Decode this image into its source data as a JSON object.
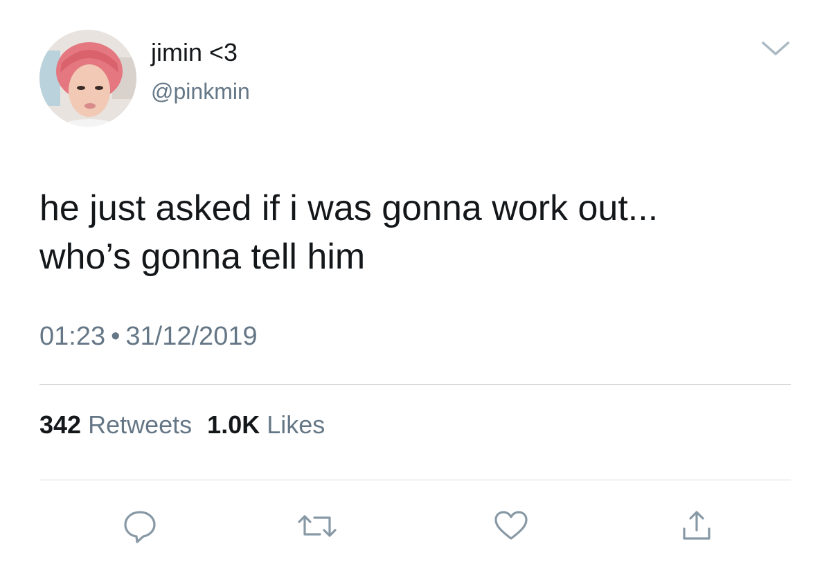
{
  "user": {
    "display_name": "jimin <3",
    "handle": "@pinkmin",
    "avatar_icon": "profile-photo"
  },
  "tweet": {
    "lines": [
      "he just asked if i was gonna work out...",
      "who’s gonna tell him"
    ],
    "time": "01:23",
    "separator": "•",
    "date": "31/12/2019"
  },
  "stats": {
    "retweets_count": "342",
    "retweets_label": "Retweets",
    "likes_count": "1.0K",
    "likes_label": "Likes"
  },
  "actions": [
    {
      "name": "reply",
      "icon": "reply-icon"
    },
    {
      "name": "retweet",
      "icon": "retweet-icon"
    },
    {
      "name": "like",
      "icon": "heart-icon"
    },
    {
      "name": "share",
      "icon": "share-icon"
    }
  ],
  "colors": {
    "text": "#14171a",
    "secondary": "#657786",
    "divider": "#d6d9dc",
    "icon": "#8899a6",
    "avatar_hair": "#e4777f"
  }
}
